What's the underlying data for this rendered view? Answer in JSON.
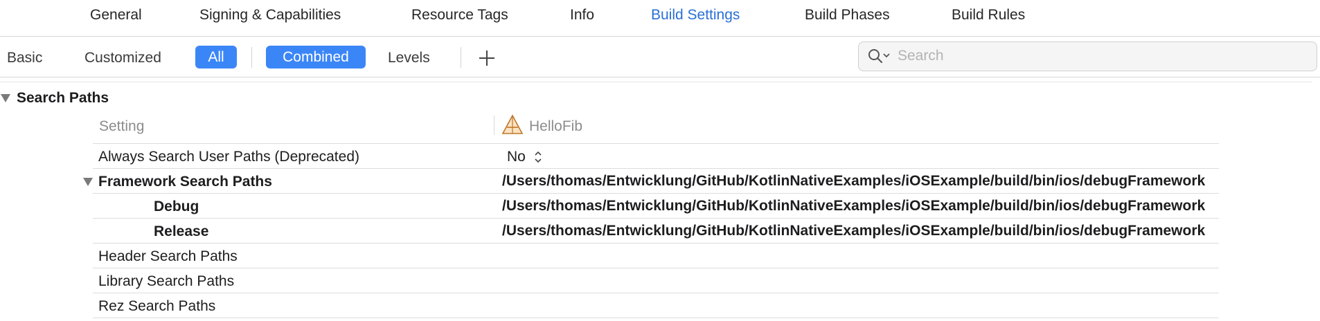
{
  "tabs": [
    {
      "label": "General",
      "active": false
    },
    {
      "label": "Signing & Capabilities",
      "active": false
    },
    {
      "label": "Resource Tags",
      "active": false
    },
    {
      "label": "Info",
      "active": false
    },
    {
      "label": "Build Settings",
      "active": true
    },
    {
      "label": "Build Phases",
      "active": false
    },
    {
      "label": "Build Rules",
      "active": false
    }
  ],
  "filters": {
    "basic": "Basic",
    "customized": "Customized",
    "all": "All",
    "combined": "Combined",
    "levels": "Levels"
  },
  "search": {
    "placeholder": "Search",
    "value": ""
  },
  "section": {
    "title": "Search Paths"
  },
  "table": {
    "header_setting": "Setting",
    "header_target": "HelloFib",
    "rows": [
      {
        "name": "Always Search User Paths (Deprecated)",
        "value": "No"
      },
      {
        "name": "Framework Search Paths",
        "value": "/Users/thomas/Entwicklung/GitHub/KotlinNativeExamples/iOSExample/build/bin/ios/debugFramework"
      },
      {
        "name": "Debug",
        "value": "/Users/thomas/Entwicklung/GitHub/KotlinNativeExamples/iOSExample/build/bin/ios/debugFramework"
      },
      {
        "name": "Release",
        "value": "/Users/thomas/Entwicklung/GitHub/KotlinNativeExamples/iOSExample/build/bin/ios/debugFramework"
      },
      {
        "name": "Header Search Paths",
        "value": ""
      },
      {
        "name": "Library Search Paths",
        "value": ""
      },
      {
        "name": "Rez Search Paths",
        "value": ""
      }
    ]
  },
  "colors": {
    "accent": "#3b86f7",
    "active_tab": "#2a6fd6"
  },
  "icons": [
    "plus-icon",
    "search-icon",
    "disclosure-triangle-icon",
    "target-app-icon",
    "stepper-icon"
  ]
}
